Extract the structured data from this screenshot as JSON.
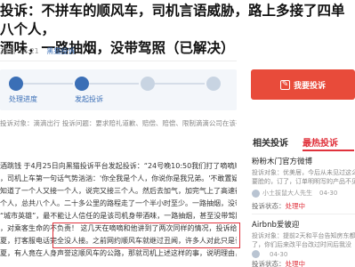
{
  "article": {
    "title_line1": "投诉：不拼车的顺风车，司机言语威胁，路上多接了四单八个人，",
    "title_line2": "酒味，一路抽烟，没带驾照（已解决）",
    "date": "25日 14:21",
    "category": "黑猫投诉"
  },
  "progress": {
    "steps": [
      {
        "label": "处理进度",
        "active": true
      },
      {
        "label": "发起投诉",
        "active": true
      },
      {
        "label": "",
        "active": false
      },
      {
        "label": "",
        "active": false
      }
    ]
  },
  "abstract": "投诉对象：滴滴出行   投诉问题：要求赔礼道歉、赔偿、赔偿、限制滴滴公司在该平台的服务，目前仍未回复",
  "body_lines": [
    "酒跳钱 于4月25日向黑猫投诉平台发起投诉：“24号晚10:50我们打了嘀嘀顺风车回家，设置的不",
    "，司机上车第一句话气势汹汹：'你全我是个人，你说你是我兄弟。'不敢置疑，我忍了，没",
    "知道了一个人又接一个人，说完又接三个人。然后去加气，加完气上了高速往回走，中途又接",
    "个人，总共八个人。二十多公里的路程走了一个半小时至少。一路抽烟，没带驾照。",
    "“城市英雄”，最不能让人信任的是该司机身带酒味，一路抽烟，甚至没带驾照。投诉对网约车",
    "，对乘客生命的不负责！ 这几天在嘀嘀和他讲到了两次同样的情况，投诉给客户完全做用“交",
    "夏，打客服电话完全没人接。之前网约顺风车就继过丑闻，许多人对此只是认为这只是启发之",
    "夏，有人竟在人身声誉这顺风车的公路，那就司机上述这样的事，说明理由，我希望能引起"
  ],
  "actions": {
    "complain_label": "我要投诉"
  },
  "tabs": {
    "related": "相关投诉",
    "hot": "最热投诉"
  },
  "hot_list": [
    {
      "title": "粉粉木门官方微博",
      "desc": "投诉对象：优美居，今后从未见过这么不",
      "desc2": "要脸的，订了，订单明明写的产品不见了",
      "user": "小土拔鼠大人先生",
      "date": "04-30",
      "status_label": "投诉状态：",
      "status": "处理中"
    },
    {
      "title": "Airbnb爱彼迎",
      "desc": "投诉对象：提前2天和平台告知房东都拒绝",
      "desc2": "了，你们后来改平台改过时间后我没",
      "user": "",
      "date": "04-30",
      "status_label": "投诉状态：",
      "status": "处理中"
    }
  ],
  "colors": {
    "accent_red": "#e84b3a",
    "link_blue": "#3b6fb6",
    "highlight_border": "#e0323c"
  }
}
